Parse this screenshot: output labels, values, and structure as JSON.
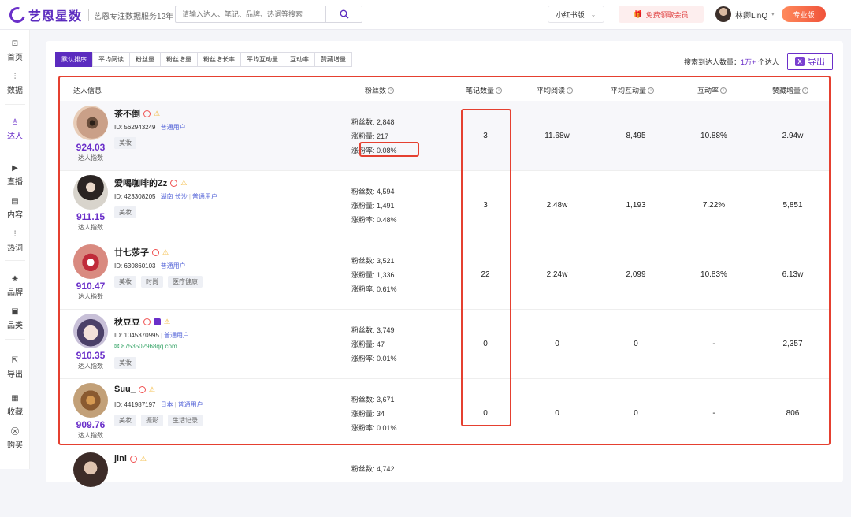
{
  "header": {
    "logo_text": "艺恩星数",
    "logo_sub": "艺恩专注数据服务12年",
    "search_placeholder": "请输入达人、笔记、品牌、热词等搜索",
    "platform": "小红书版",
    "vip_label": "免费领取会员",
    "username": "林卿LinQ",
    "pro_label": "专业版"
  },
  "sidebar": [
    {
      "label": "首页",
      "icon": "monitor-icon",
      "glyph": "⊡"
    },
    {
      "label": "数据",
      "icon": "bar-chart-icon",
      "glyph": "⫶"
    },
    {
      "label": "达人",
      "icon": "person-icon",
      "glyph": "♙"
    },
    {
      "label": "直播",
      "icon": "play-icon",
      "glyph": "▶"
    },
    {
      "label": "内容",
      "icon": "document-icon",
      "glyph": "▤"
    },
    {
      "label": "热词",
      "icon": "bar-chart-icon",
      "glyph": "⫶"
    },
    {
      "label": "品牌",
      "icon": "diamond-icon",
      "glyph": "◈"
    },
    {
      "label": "品类",
      "icon": "box-icon",
      "glyph": "▣"
    },
    {
      "label": "导出",
      "icon": "export-icon",
      "glyph": "⇱"
    },
    {
      "label": "收藏",
      "icon": "bookmark-icon",
      "glyph": "▦"
    },
    {
      "label": "购买",
      "icon": "cart-icon",
      "glyph": "⛒"
    }
  ],
  "tabs": [
    "默认排序",
    "平均阅读",
    "粉丝量",
    "粉丝增量",
    "粉丝增长率",
    "平均互动量",
    "互动率",
    "赞藏增量"
  ],
  "result": {
    "prefix": "搜索到达人数量：",
    "count": "1万+",
    "suffix": "个达人"
  },
  "export_label": "导出",
  "columns": {
    "info": "达人信息",
    "fans": "粉丝数",
    "notes": "笔记数量",
    "avg_read": "平均阅读",
    "avg_interact": "平均互动量",
    "interact_rate": "互动率",
    "like_growth": "赞藏增量"
  },
  "score_label": "达人指数",
  "rows": [
    {
      "name": "茶不倒",
      "id": "ID: 562943249",
      "location": "",
      "user_type": "普通用户",
      "email": "",
      "tags": [
        "美妆"
      ],
      "score": "924.03",
      "fans": "粉丝数: 2,848",
      "fans_inc": "涨粉量: 217",
      "fans_rate": "涨粉率: 0.08%",
      "notes": "3",
      "avg_read": "11.68w",
      "avg_interact": "8,495",
      "interact_rate": "10.88%",
      "like_growth": "2.94w"
    },
    {
      "name": "爱喝咖啡的Zz",
      "id": "ID: 423308205",
      "location": "湖南 长沙",
      "user_type": "普通用户",
      "email": "",
      "tags": [
        "美妆"
      ],
      "score": "911.15",
      "fans": "粉丝数: 4,594",
      "fans_inc": "涨粉量: 1,491",
      "fans_rate": "涨粉率: 0.48%",
      "notes": "3",
      "avg_read": "2.48w",
      "avg_interact": "1,193",
      "interact_rate": "7.22%",
      "like_growth": "5,851"
    },
    {
      "name": "廿七莎子",
      "id": "ID: 630860103",
      "location": "",
      "user_type": "普通用户",
      "email": "",
      "tags": [
        "美妆",
        "时尚",
        "医疗健康"
      ],
      "score": "910.47",
      "fans": "粉丝数: 3,521",
      "fans_inc": "涨粉量: 1,336",
      "fans_rate": "涨粉率: 0.61%",
      "notes": "22",
      "avg_read": "2.24w",
      "avg_interact": "2,099",
      "interact_rate": "10.83%",
      "like_growth": "6.13w"
    },
    {
      "name": "秋豆豆",
      "id": "ID: 1045370995",
      "location": "",
      "user_type": "普通用户",
      "email": "8753502968qq.com",
      "tags": [
        "美妆"
      ],
      "score": "910.35",
      "fans": "粉丝数: 3,749",
      "fans_inc": "涨粉量: 47",
      "fans_rate": "涨粉率: 0.01%",
      "notes": "0",
      "avg_read": "0",
      "avg_interact": "0",
      "interact_rate": "-",
      "like_growth": "2,357"
    },
    {
      "name": "Suu_",
      "id": "ID: 441987197",
      "location": "日本",
      "user_type": "普通用户",
      "email": "",
      "tags": [
        "美妆",
        "摄影",
        "生活记录"
      ],
      "score": "909.76",
      "fans": "粉丝数: 3,671",
      "fans_inc": "涨粉量: 34",
      "fans_rate": "涨粉率: 0.01%",
      "notes": "0",
      "avg_read": "0",
      "avg_interact": "0",
      "interact_rate": "-",
      "like_growth": "806"
    },
    {
      "name": "jini",
      "id": "",
      "location": "",
      "user_type": "",
      "email": "",
      "tags": [],
      "score": "",
      "fans": "粉丝数: 4,742",
      "fans_inc": "",
      "fans_rate": "",
      "notes": "",
      "avg_read": "",
      "avg_interact": "",
      "interact_rate": "",
      "like_growth": ""
    }
  ],
  "colors": {
    "brand": "#6a2fc9",
    "highlight": "#e54030",
    "link": "#5565d8"
  }
}
